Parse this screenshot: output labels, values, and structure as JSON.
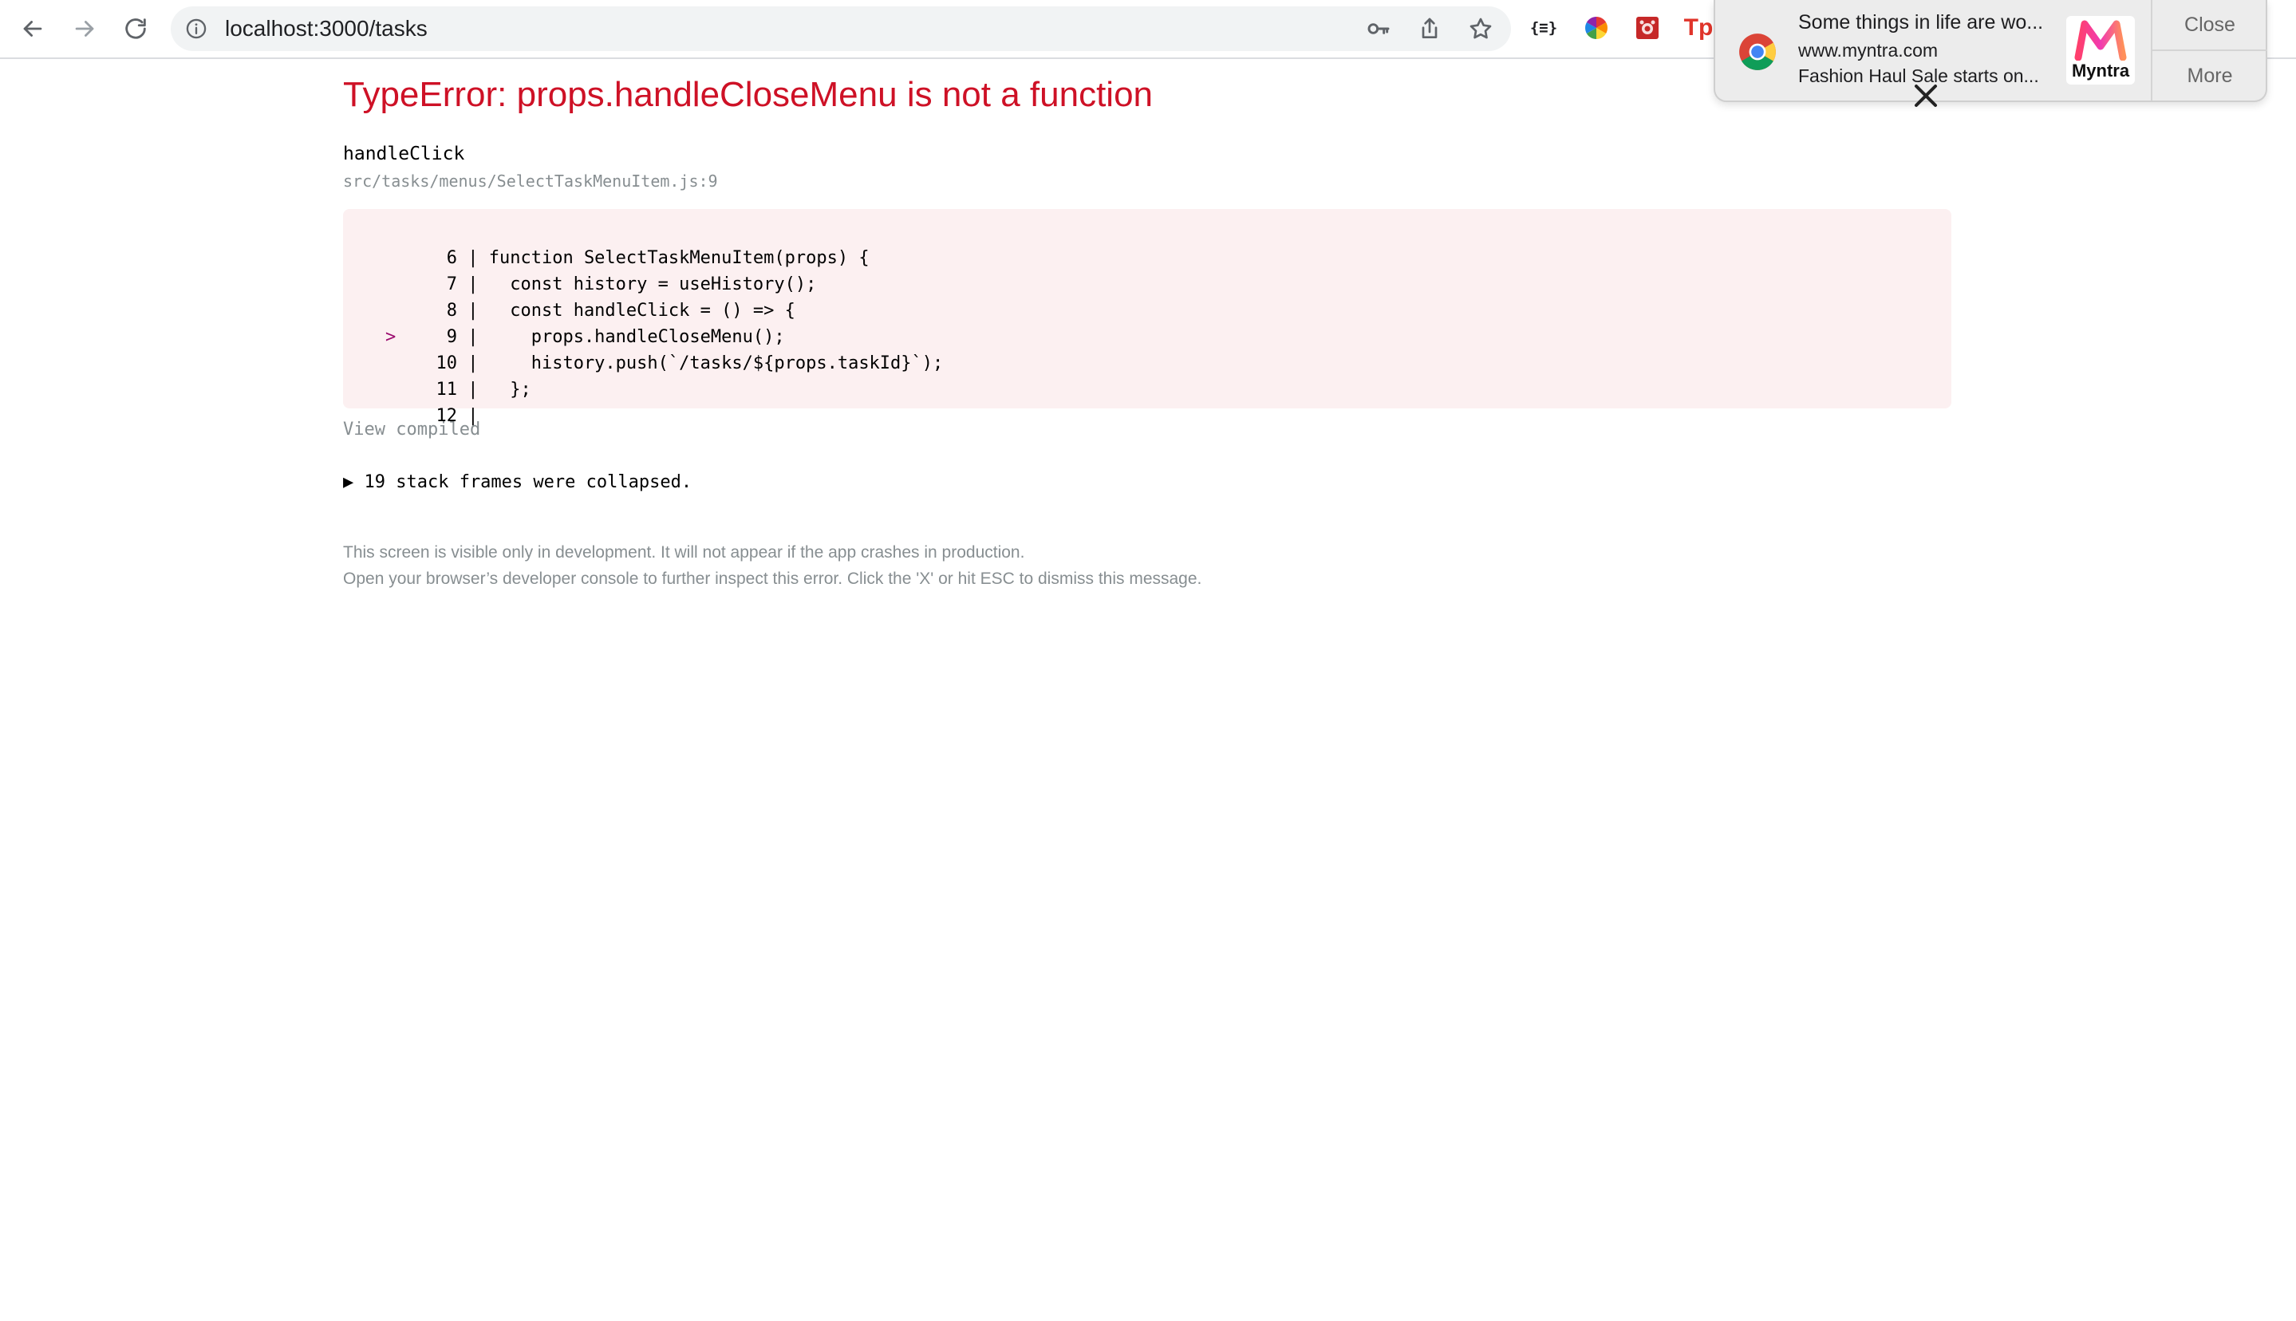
{
  "browser": {
    "url": "localhost:3000/tasks",
    "extensions": {
      "json_viewer_label": "{≡}",
      "tp_label": "Tp"
    }
  },
  "notification": {
    "title": "Some things in life are wo...",
    "site": "www.myntra.com",
    "body": "Fashion Haul Sale starts on...",
    "brand_label": "Myntra",
    "close_label": "Close",
    "more_label": "More"
  },
  "error": {
    "title": "TypeError: props.handleCloseMenu is not a function",
    "frame_function": "handleClick",
    "frame_file": "src/tasks/menus/SelectTaskMenuItem.js:9",
    "code_lines": [
      {
        "marker": "",
        "num": "6",
        "code": "function SelectTaskMenuItem(props) {"
      },
      {
        "marker": "",
        "num": "7",
        "code": "  const history = useHistory();"
      },
      {
        "marker": "",
        "num": "8",
        "code": "  const handleClick = () => {"
      },
      {
        "marker": ">",
        "num": "9",
        "code": "    props.handleCloseMenu();"
      },
      {
        "marker": "",
        "num": "10",
        "code": "    history.push(`/tasks/${props.taskId}`);"
      },
      {
        "marker": "",
        "num": "11",
        "code": "  };"
      },
      {
        "marker": "",
        "num": "12",
        "code": ""
      }
    ],
    "view_compiled": "View compiled",
    "stack_frames": "▶ 19 stack frames were collapsed.",
    "footer_line1": "This screen is visible only in development. It will not appear if the app crashes in production.",
    "footer_line2": "Open your browser’s developer console to further inspect this error.  Click the 'X' or hit ESC to dismiss this message."
  },
  "colors": {
    "error_red": "#ce1126",
    "code_bg": "#fcf0f1",
    "muted_gray": "#878e91"
  }
}
